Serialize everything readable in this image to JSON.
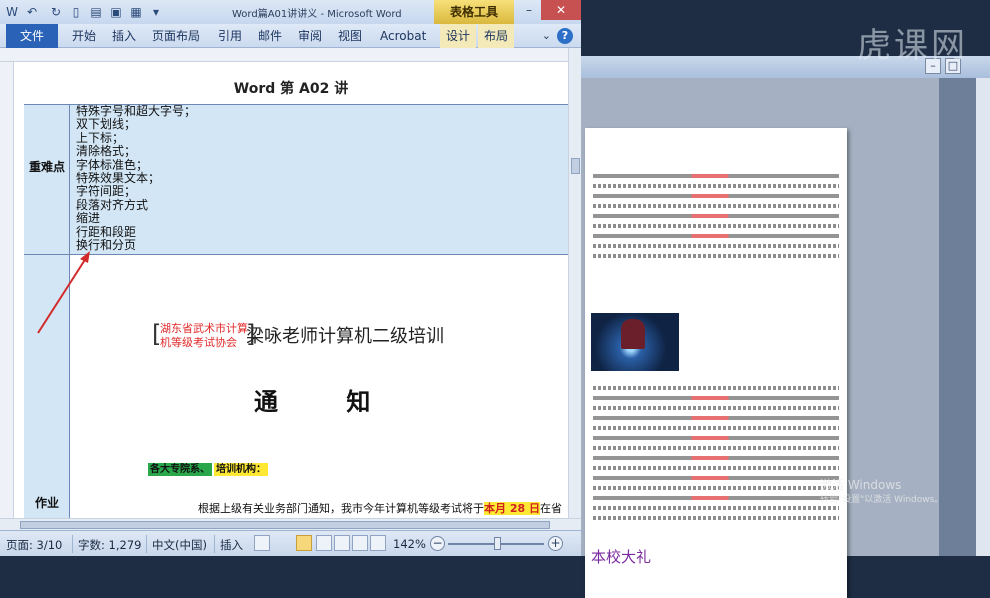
{
  "window": {
    "title": "Word篇A01讲讲义 - Microsoft Word",
    "context_group": "表格工具"
  },
  "ribbon": {
    "file": "文件",
    "tabs": [
      "开始",
      "插入",
      "页面布局",
      "引用",
      "邮件",
      "审阅",
      "视图",
      "Acrobat"
    ],
    "context_tabs": [
      "设计",
      "布局"
    ]
  },
  "document": {
    "title": "Word 第 A02 讲",
    "row1_header": "重难点",
    "items": [
      "特殊字号和超大字号；",
      "双下划线；",
      "上下标；",
      "清除格式；",
      "字体标准色；",
      "特殊效果文本；",
      "字符间距；",
      "段落对齐方式",
      "缩进",
      "行距和段距",
      "换行和分页"
    ],
    "row2_header": "作业",
    "org_line1": "湖东省武术市计算",
    "org_line2": "机等级考试协会",
    "org_title": "梁咏老师计算机二级培训",
    "notice": "通 知",
    "tag1": "各大专院系、",
    "tag2": "培训机构：",
    "para_before": "根据上级有关业务部门通知，我市今年计算机等级考试将于",
    "para_highlight": "本月 28 日",
    "para_after": "在省科技"
  },
  "background_doc": {
    "big_text": "本校大礼"
  },
  "status": {
    "page": "页面: 3/10",
    "words": "字数: 1,279",
    "lang": "中文(中国)",
    "mode": "插入",
    "zoom": "142%"
  },
  "watermark": {
    "logo": "虎课网",
    "activate_line1": "激活 Windows",
    "activate_line2": "转到\"设置\"以激活 Windows。"
  },
  "colors": {
    "file_tab": "#2a62b8",
    "table_header_fill": "#d3e6f5",
    "context_tab": "#f4e9b8",
    "arrow": "#d22a2a",
    "highlight_yellow": "#ffe833",
    "highlight_green": "#2aa64b"
  }
}
